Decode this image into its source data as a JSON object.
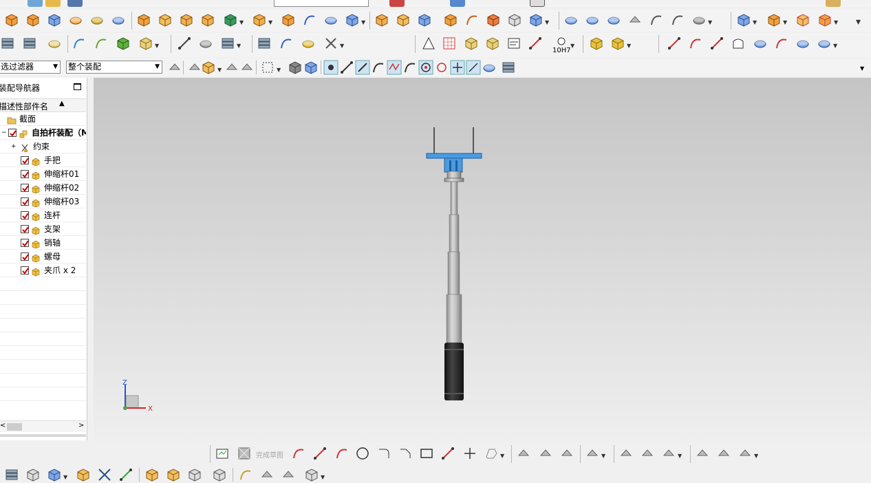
{
  "filters": {
    "selection_filter": "选过滤器",
    "scope": "整个装配"
  },
  "navigator": {
    "title": "装配导航器",
    "column_header": "描述性部件名",
    "items": [
      {
        "label": "截面",
        "type": "folder",
        "checked": false
      },
      {
        "label": "自拍杆装配（MC",
        "type": "assembly",
        "checked": true,
        "bold": true
      },
      {
        "label": "约束",
        "type": "constraints",
        "checked": false
      },
      {
        "label": "手把",
        "type": "part",
        "checked": true
      },
      {
        "label": "伸缩杆01",
        "type": "part",
        "checked": true
      },
      {
        "label": "伸缩杆02",
        "type": "part",
        "checked": true
      },
      {
        "label": "伸缩杆03",
        "type": "part",
        "checked": true
      },
      {
        "label": "连杆",
        "type": "part",
        "checked": true
      },
      {
        "label": "支架",
        "type": "part",
        "checked": true
      },
      {
        "label": "销轴",
        "type": "part",
        "checked": true
      },
      {
        "label": "螺母",
        "type": "part",
        "checked": true
      },
      {
        "label": "夹爪 x 2",
        "type": "part",
        "checked": true
      }
    ]
  },
  "sketch_toolbar": {
    "finish_sketch": "完成草图"
  },
  "toolbar_labels": {
    "fit_label": "10H7"
  },
  "triad": {
    "z": "Z",
    "x": "X"
  },
  "colors": {
    "selection_blue": "#4a9be0",
    "handle_dark": "#2a2a2a",
    "rod_gray": "#b4b4b4",
    "check_red": "#cc0000"
  }
}
